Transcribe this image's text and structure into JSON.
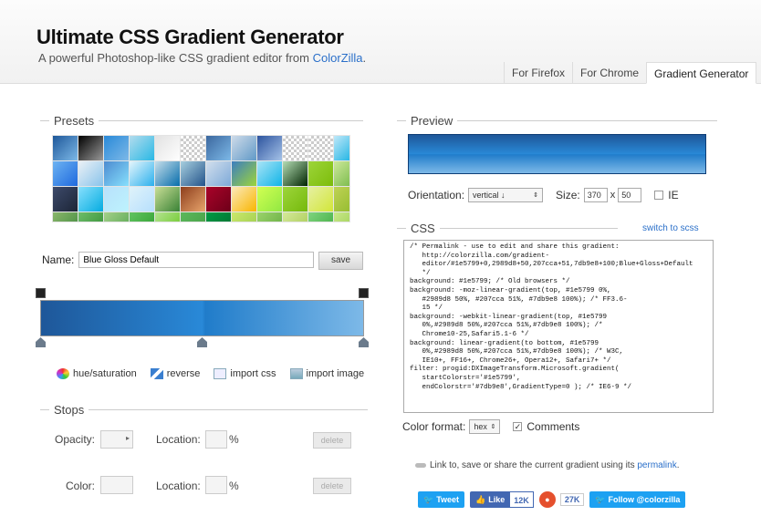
{
  "header": {
    "title": "Ultimate CSS Gradient Generator",
    "subtitle": "A powerful Photoshop-like CSS gradient editor from",
    "subtitle_link": "ColorZilla",
    "subtitle_end": ".",
    "nav": [
      "For Firefox",
      "For Chrome",
      "Gradient Generator"
    ]
  },
  "presets": {
    "legend": "Presets",
    "swatch_icons": "gradient-preset-swatches"
  },
  "name_row": {
    "label": "Name:",
    "value": "Blue Gloss Default",
    "save_label": "save"
  },
  "tools": {
    "hue": "hue/saturation",
    "reverse": "reverse",
    "import_css": "import css",
    "import_image": "import image"
  },
  "stops": {
    "legend": "Stops",
    "opacity_label": "Opacity:",
    "location_label": "Location:",
    "color_label": "Color:",
    "pct": "%",
    "delete_label": "delete"
  },
  "preview": {
    "legend": "Preview",
    "orientation_label": "Orientation:",
    "orientation_value": "vertical ↓",
    "size_label": "Size:",
    "width": "370",
    "x": "x",
    "height": "50",
    "ie_label": "IE"
  },
  "css": {
    "legend": "CSS",
    "switch_label": "switch to scss",
    "code": "/* Permalink - use to edit and share this gradient:\n   http://colorzilla.com/gradient-\n   editor/#1e5799+0,2989d8+50,207cca+51,7db9e8+100;Blue+Gloss+Default\n   */\nbackground: #1e5799; /* Old browsers */\nbackground: -moz-linear-gradient(top, #1e5799 0%,\n   #2989d8 50%, #207cca 51%, #7db9e8 100%); /* FF3.6-\n   15 */\nbackground: -webkit-linear-gradient(top, #1e5799\n   0%,#2989d8 50%,#207cca 51%,#7db9e8 100%); /*\n   Chrome10-25,Safari5.1-6 */\nbackground: linear-gradient(to bottom, #1e5799\n   0%,#2989d8 50%,#207cca 51%,#7db9e8 100%); /* W3C,\n   IE10+, FF16+, Chrome26+, Opera12+, Safari7+ */\nfilter: progid:DXImageTransform.Microsoft.gradient(\n   startColorstr='#1e5799',\n   endColorstr='#7db9e8',GradientType=0 ); /* IE6-9 */"
  },
  "format_row": {
    "label": "Color format:",
    "value": "hex",
    "comments_label": "Comments"
  },
  "permalink": {
    "text": "Link to, save or share the current gradient using its",
    "link": "permalink",
    "end": "."
  },
  "social": {
    "tweet": "Tweet",
    "like": "Like",
    "like_count": "12K",
    "plus_count": "27K",
    "follow": "Follow @colorzilla"
  },
  "colors": {
    "grad_top": "#1e5799",
    "grad_mid": "#2989d8",
    "grad_mid2": "#207cca",
    "grad_bottom": "#7db9e8",
    "link": "#2a6fc9"
  }
}
